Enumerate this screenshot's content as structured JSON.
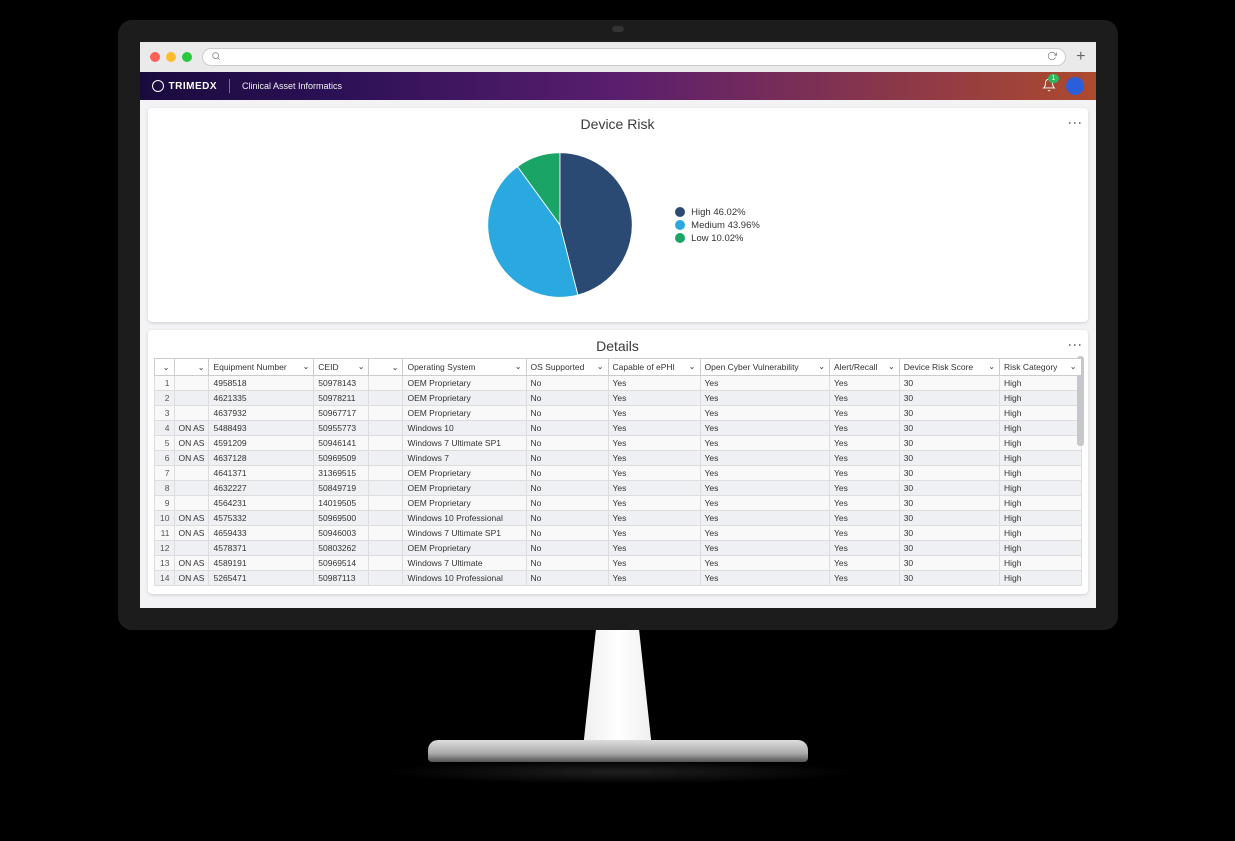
{
  "header": {
    "brand": "TRIMEDX",
    "app_title": "Clinical Asset Informatics",
    "notification_count": "1"
  },
  "chart_card": {
    "title": "Device Risk"
  },
  "chart_data": {
    "type": "pie",
    "title": "Device Risk",
    "series": [
      {
        "name": "High",
        "value": 46.02,
        "color": "#2a4a73",
        "legend": "High  46.02%"
      },
      {
        "name": "Medium",
        "value": 43.96,
        "color": "#2aa9e0",
        "legend": "Medium  43.96%"
      },
      {
        "name": "Low",
        "value": 10.02,
        "color": "#1aa566",
        "legend": "Low  10.02%"
      }
    ]
  },
  "details": {
    "title": "Details",
    "columns": [
      "",
      "",
      "Equipment Number",
      "CEID",
      "",
      "Operating System",
      "OS Supported",
      "Capable of ePHI",
      "Open Cyber Vulnerability",
      "Alert/Recall",
      "Device Risk Score",
      "Risk Category"
    ],
    "rows": [
      [
        "1",
        "",
        "4958518",
        "50978143",
        "",
        "OEM Proprietary",
        "No",
        "Yes",
        "Yes",
        "Yes",
        "30",
        "High"
      ],
      [
        "2",
        "",
        "4621335",
        "50978211",
        "",
        "OEM Proprietary",
        "No",
        "Yes",
        "Yes",
        "Yes",
        "30",
        "High"
      ],
      [
        "3",
        "",
        "4637932",
        "50967717",
        "",
        "OEM Proprietary",
        "No",
        "Yes",
        "Yes",
        "Yes",
        "30",
        "High"
      ],
      [
        "4",
        "ON AS",
        "5488493",
        "50955773",
        "",
        "Windows 10",
        "No",
        "Yes",
        "Yes",
        "Yes",
        "30",
        "High"
      ],
      [
        "5",
        "ON AS",
        "4591209",
        "50946141",
        "",
        "Windows 7 Ultimate SP1",
        "No",
        "Yes",
        "Yes",
        "Yes",
        "30",
        "High"
      ],
      [
        "6",
        "ON AS",
        "4637128",
        "50969509",
        "",
        "Windows 7",
        "No",
        "Yes",
        "Yes",
        "Yes",
        "30",
        "High"
      ],
      [
        "7",
        "",
        "4641371",
        "31369515",
        "",
        "OEM Proprietary",
        "No",
        "Yes",
        "Yes",
        "Yes",
        "30",
        "High"
      ],
      [
        "8",
        "",
        "4632227",
        "50849719",
        "",
        "OEM Proprietary",
        "No",
        "Yes",
        "Yes",
        "Yes",
        "30",
        "High"
      ],
      [
        "9",
        "",
        "4564231",
        "14019505",
        "",
        "OEM Proprietary",
        "No",
        "Yes",
        "Yes",
        "Yes",
        "30",
        "High"
      ],
      [
        "10",
        "ON AS",
        "4575332",
        "50969500",
        "",
        "Windows 10 Professional",
        "No",
        "Yes",
        "Yes",
        "Yes",
        "30",
        "High"
      ],
      [
        "11",
        "ON AS",
        "4659433",
        "50946003",
        "",
        "Windows 7 Ultimate SP1",
        "No",
        "Yes",
        "Yes",
        "Yes",
        "30",
        "High"
      ],
      [
        "12",
        "",
        "4578371",
        "50803262",
        "",
        "OEM Proprietary",
        "No",
        "Yes",
        "Yes",
        "Yes",
        "30",
        "High"
      ],
      [
        "13",
        "ON AS",
        "4589191",
        "50969514",
        "",
        "Windows 7 Ultimate",
        "No",
        "Yes",
        "Yes",
        "Yes",
        "30",
        "High"
      ],
      [
        "14",
        "ON AS",
        "5265471",
        "50987113",
        "",
        "Windows  10 Professional",
        "No",
        "Yes",
        "Yes",
        "Yes",
        "30",
        "High"
      ]
    ]
  }
}
